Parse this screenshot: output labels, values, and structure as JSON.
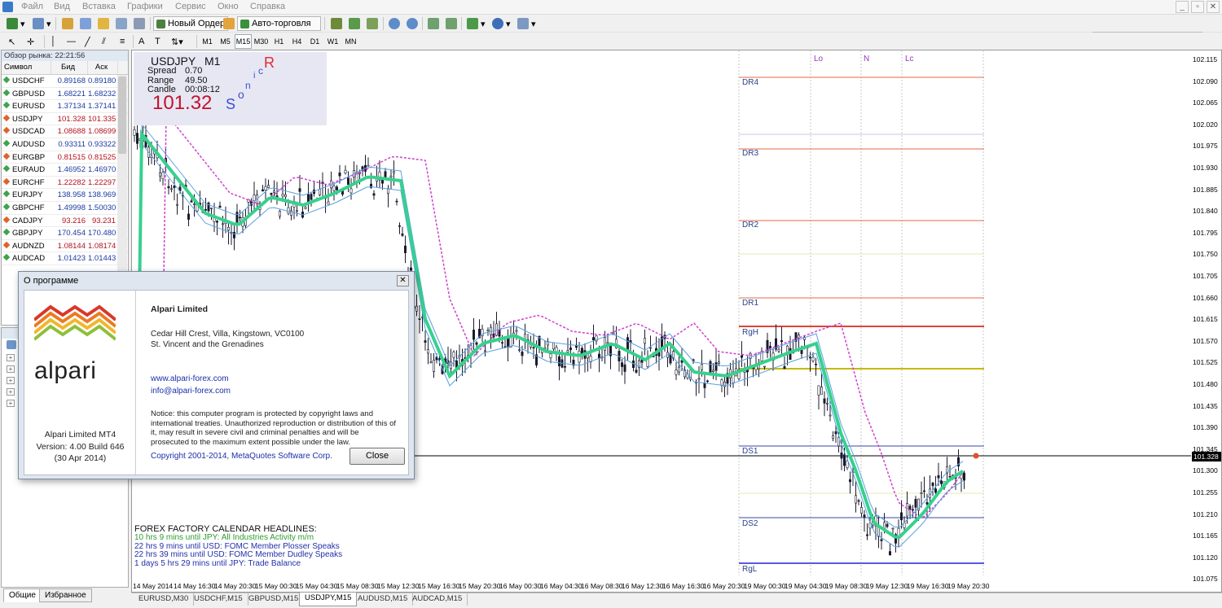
{
  "menu": [
    "Файл",
    "Вид",
    "Вставка",
    "Графики",
    "Сервис",
    "Окно",
    "Справка"
  ],
  "toolbar": {
    "new_order_label": "Новый Ордер",
    "autotrading_label": "Авто-торговля",
    "timeframes": [
      "M1",
      "M5",
      "M15",
      "M30",
      "H1",
      "H4",
      "D1",
      "W1",
      "MN"
    ],
    "active_timeframe": "M15"
  },
  "market_watch": {
    "title": "Обзор рынка: 22:21:56",
    "columns": [
      "Символ",
      "Бид",
      "Аск"
    ],
    "rows": [
      {
        "symbol": "USDCHF",
        "bid": "0.89168",
        "ask": "0.89180",
        "dir": "up"
      },
      {
        "symbol": "GBPUSD",
        "bid": "1.68221",
        "ask": "1.68232",
        "dir": "up"
      },
      {
        "symbol": "EURUSD",
        "bid": "1.37134",
        "ask": "1.37141",
        "dir": "up"
      },
      {
        "symbol": "USDJPY",
        "bid": "101.328",
        "ask": "101.335",
        "dir": "down"
      },
      {
        "symbol": "USDCAD",
        "bid": "1.08688",
        "ask": "1.08699",
        "dir": "down"
      },
      {
        "symbol": "AUDUSD",
        "bid": "0.93311",
        "ask": "0.93322",
        "dir": "up"
      },
      {
        "symbol": "EURGBP",
        "bid": "0.81515",
        "ask": "0.81525",
        "dir": "down"
      },
      {
        "symbol": "EURAUD",
        "bid": "1.46952",
        "ask": "1.46970",
        "dir": "up"
      },
      {
        "symbol": "EURCHF",
        "bid": "1.22282",
        "ask": "1.22297",
        "dir": "down"
      },
      {
        "symbol": "EURJPY",
        "bid": "138.958",
        "ask": "138.969",
        "dir": "up"
      },
      {
        "symbol": "GBPCHF",
        "bid": "1.49998",
        "ask": "1.50030",
        "dir": "up"
      },
      {
        "symbol": "CADJPY",
        "bid": "93.216",
        "ask": "93.231",
        "dir": "down"
      },
      {
        "symbol": "GBPJPY",
        "bid": "170.454",
        "ask": "170.480",
        "dir": "up"
      },
      {
        "symbol": "AUDNZD",
        "bid": "1.08144",
        "ask": "1.08174",
        "dir": "down"
      },
      {
        "symbol": "AUDCAD",
        "bid": "1.01423",
        "ask": "1.01443",
        "dir": "up"
      }
    ]
  },
  "navigator": {
    "tabs": [
      "Общие",
      "Избранное"
    ]
  },
  "chart": {
    "symbol_tf": "USDJPY,M15",
    "info": {
      "symbol": "USDJPY",
      "tf": "M1",
      "spread_label": "Spread",
      "spread": "0.70",
      "range_label": "Range",
      "range": "49.50",
      "candle_label": "Candle",
      "candle": "00:08:12",
      "price": "101.32",
      "sonic": [
        "S",
        "o",
        "n",
        "i",
        "c",
        "R"
      ]
    },
    "pivot_labels": [
      "DR4",
      "DR3",
      "DR2",
      "DR1",
      "RgH",
      "DS1",
      "DS2",
      "RgL"
    ],
    "session_labels": [
      "Lo",
      "N",
      "Lc"
    ],
    "price_axis": [
      "102.115",
      "102.090",
      "102.065",
      "102.020",
      "101.975",
      "101.930",
      "101.885",
      "101.840",
      "101.795",
      "101.750",
      "101.705",
      "101.660",
      "101.615",
      "101.570",
      "101.525",
      "101.480",
      "101.435",
      "101.390",
      "101.345",
      "101.300",
      "101.255",
      "101.210",
      "101.165",
      "101.120",
      "101.075"
    ],
    "current_price": "101.328",
    "time_axis": [
      "14 May 2014",
      "14 May 16:30",
      "14 May 20:30",
      "15 May 00:30",
      "15 May 04:30",
      "15 May 08:30",
      "15 May 12:30",
      "15 May 16:30",
      "15 May 20:30",
      "16 May 00:30",
      "16 May 04:30",
      "16 May 08:30",
      "16 May 12:30",
      "16 May 16:30",
      "16 May 20:30",
      "19 May 00:30",
      "19 May 04:30",
      "19 May 08:30",
      "19 May 12:30",
      "19 May 16:30",
      "19 May 20:30"
    ],
    "news": {
      "heading": "FOREX FACTORY CALENDAR HEADLINES:",
      "items": [
        {
          "text": "10 hrs 9 mins until JPY: All Industries Activity m/m",
          "color": "#2d9c2d"
        },
        {
          "text": "22 hrs 9 mins until USD: FOMC Member Plosser Speaks",
          "color": "#2230a8"
        },
        {
          "text": "22 hrs 39 mins until USD: FOMC Member Dudley Speaks",
          "color": "#2230a8"
        },
        {
          "text": "1 days 5 hrs 29 mins until JPY: Trade Balance",
          "color": "#2230a8"
        }
      ]
    }
  },
  "chart_tabs": [
    "EURUSD,M30",
    "USDCHF,M15",
    "GBPUSD,M15",
    "USDJPY,M15",
    "AUDUSD,M15",
    "AUDCAD,M15"
  ],
  "active_chart_tab": "USDJPY,M15",
  "about": {
    "title": "О программе",
    "company": "Alpari Limited",
    "address1": "Cedar Hill Crest, Villa, Kingstown, VC0100",
    "address2": "St. Vincent and the Grenadines",
    "website": "www.alpari-forex.com",
    "email": "info@alpari-forex.com",
    "notice": "Notice: this computer program is protected by copyright laws and international treaties. Unauthorized reproduction or distribution of this of it, may result in severe civil and criminal penalties and will be prosecuted to the maximum extent possible under the law.",
    "copyright": "Copyright 2001-2014, MetaQuotes Software Corp.",
    "logo_text": "alpari",
    "product": "Alpari Limited MT4",
    "version": "Version: 4.00  Build 646",
    "date": "(30 Apr 2014)",
    "close_label": "Close"
  }
}
